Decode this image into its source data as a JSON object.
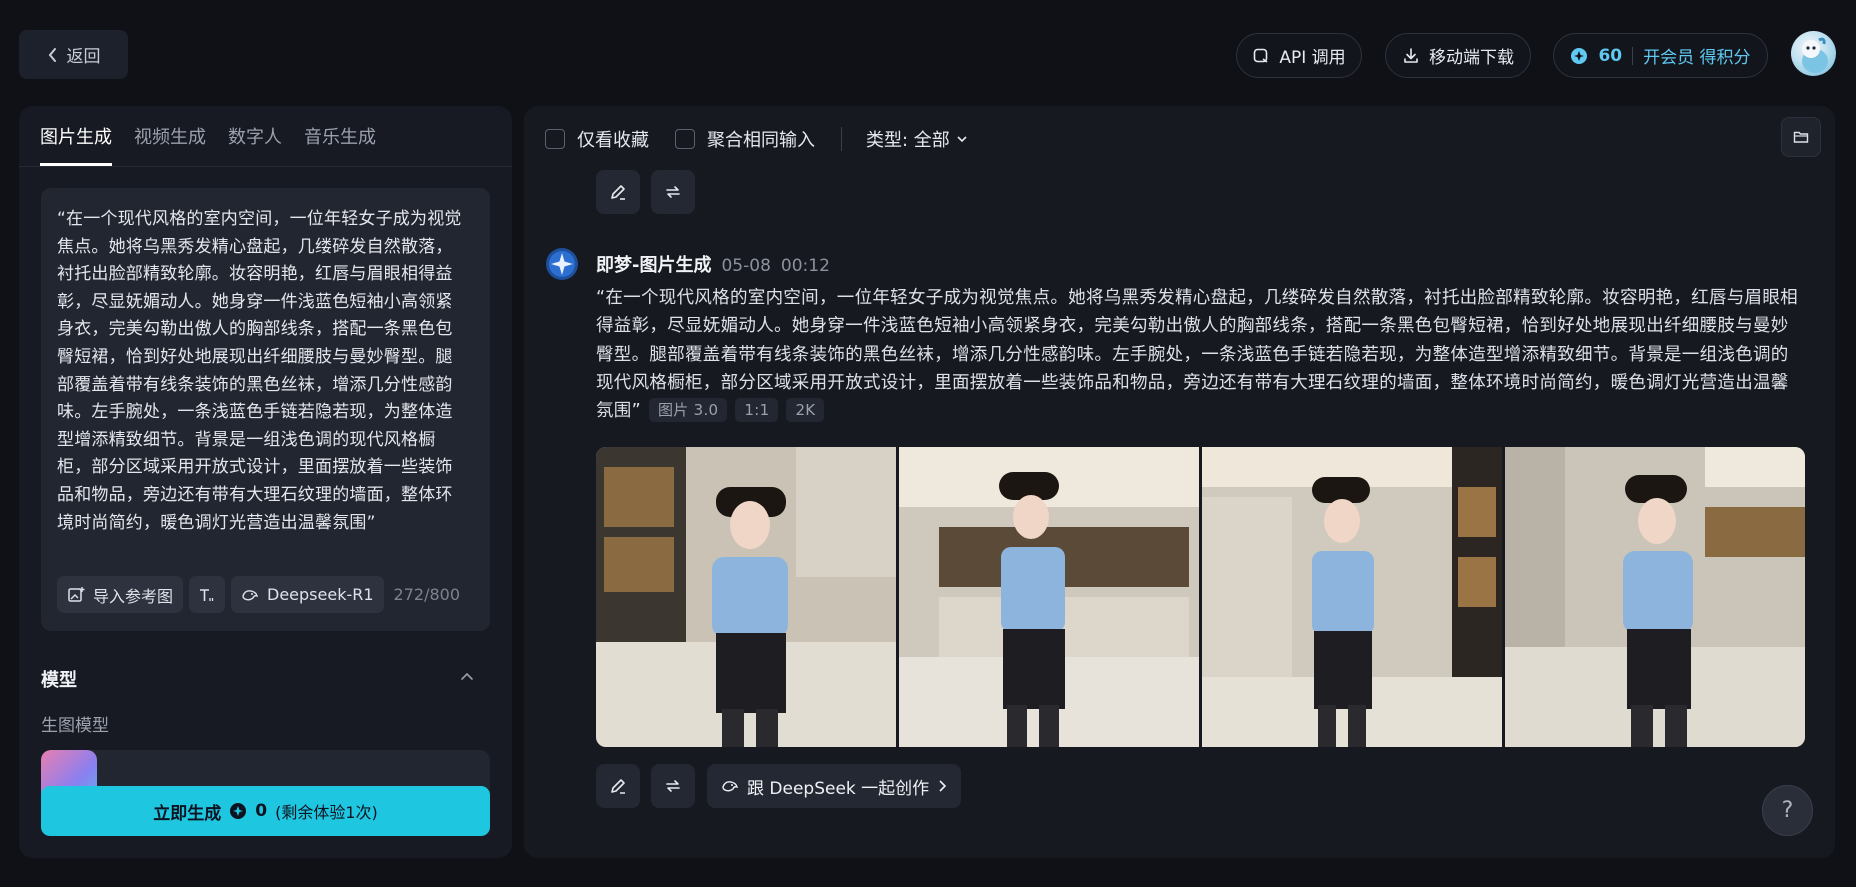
{
  "header": {
    "back_label": "返回",
    "api_label": "API 调用",
    "download_label": "移动端下载",
    "credits": "60",
    "vip_label": "开会员 得积分"
  },
  "left": {
    "tabs": [
      {
        "label": "图片生成",
        "active": true
      },
      {
        "label": "视频生成"
      },
      {
        "label": "数字人"
      },
      {
        "label": "音乐生成"
      }
    ],
    "prompt": "“在一个现代风格的室内空间，一位年轻女子成为视觉焦点。她将乌黑秀发精心盘起，几缕碎发自然散落，衬托出脸部精致轮廓。妆容明艳，红唇与眉眼相得益彰，尽显妩媚动人。她身穿一件浅蓝色短袖小高领紧身衣，完美勾勒出傲人的胸部线条，搭配一条黑色包臀短裙，恰到好处地展现出纤细腰肢与曼妙臀型。腿部覆盖着带有线条装饰的黑色丝袜，增添几分性感韵味。左手腕处，一条浅蓝色手链若隐若现，为整体造型增添精致细节。背景是一组浅色调的现代风格橱柜，部分区域采用开放式设计，里面摆放着一些装饰品和物品，旁边还有带有大理石纹理的墙面，整体环境时尚简约，暖色调灯光营造出温馨氛围”",
    "import_ref_label": "导入参考图",
    "deepseek_label": "Deepseek-R1",
    "char_count": "272/800",
    "model_section_title": "模型",
    "model_sub_label": "生图模型",
    "generate_label": "立即生成",
    "generate_cost": "0",
    "generate_remaining": "(剩余体验1次)"
  },
  "right": {
    "filter_favorites": "仅看收藏",
    "filter_merge": "聚合相同输入",
    "type_filter": "类型: 全部",
    "record": {
      "source": "即梦-图片生成",
      "date": "05-08",
      "time": "00:12",
      "prompt": "“在一个现代风格的室内空间，一位年轻女子成为视觉焦点。她将乌黑秀发精心盘起，几缕碎发自然散落，衬托出脸部精致轮廓。妆容明艳，红唇与眉眼相得益彰，尽显妩媚动人。她身穿一件浅蓝色短袖小高领紧身衣，完美勾勒出傲人的胸部线条，搭配一条黑色包臀短裙，恰到好处地展现出纤细腰肢与曼妙臀型。腿部覆盖着带有线条装饰的黑色丝袜，增添几分性感韵味。左手腕处，一条浅蓝色手链若隐若现，为整体造型增添精致细节。背景是一组浅色调的现代风格橱柜，部分区域采用开放式设计，里面摆放着一些装饰品和物品，旁边还有带有大理石纹理的墙面，整体环境时尚简约，暖色调灯光营造出温馨氛围”",
      "tags": [
        "图片 3.0",
        "1:1",
        "2K"
      ],
      "images": [
        "generated-image-1",
        "generated-image-2",
        "generated-image-3",
        "generated-image-4"
      ]
    },
    "deepseek_cta": "跟 DeepSeek 一起创作",
    "help_label": "?"
  },
  "colors": {
    "accent": "#1fc6e0",
    "credits": "#5fc9f2",
    "background": "#0f1117",
    "panel": "#171a22"
  }
}
